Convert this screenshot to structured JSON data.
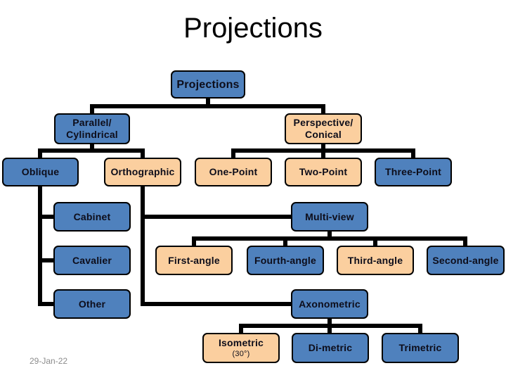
{
  "slide": {
    "title": "Projections",
    "date": "29-Jan-22"
  },
  "colors": {
    "blue_node": "#4f81bd",
    "peach_node": "#fbcf9f",
    "connector": "#000000"
  },
  "nodes": {
    "root": {
      "label": "Projections",
      "color": "blue"
    },
    "parallel": {
      "label": "Parallel/",
      "label2": "Cylindrical",
      "color": "blue"
    },
    "perspective": {
      "label": "Perspective/",
      "label2": "Conical",
      "color": "peach"
    },
    "oblique": {
      "label": "Oblique",
      "color": "blue"
    },
    "orthographic": {
      "label": "Orthographic",
      "color": "peach"
    },
    "one_point": {
      "label": "One-Point",
      "color": "peach"
    },
    "two_point": {
      "label": "Two-Point",
      "color": "peach"
    },
    "three_point": {
      "label": "Three-Point",
      "color": "blue"
    },
    "cabinet": {
      "label": "Cabinet",
      "color": "blue"
    },
    "cavalier": {
      "label": "Cavalier",
      "color": "blue"
    },
    "other": {
      "label": "Other",
      "color": "blue"
    },
    "multiview": {
      "label": "Multi-view",
      "color": "blue"
    },
    "first_angle": {
      "label": "First-angle",
      "color": "peach"
    },
    "fourth_angle": {
      "label": "Fourth-angle",
      "color": "blue"
    },
    "third_angle": {
      "label": "Third-angle",
      "color": "peach"
    },
    "second_angle": {
      "label": "Second-angle",
      "color": "blue"
    },
    "axonometric": {
      "label": "Axonometric",
      "color": "blue"
    },
    "isometric": {
      "label": "Isometric",
      "label2": "(30°)",
      "color": "peach"
    },
    "dimetric": {
      "label": "Di-metric",
      "color": "blue"
    },
    "trimetric": {
      "label": "Trimetric",
      "color": "blue"
    }
  },
  "edges": [
    [
      "root",
      "parallel"
    ],
    [
      "root",
      "perspective"
    ],
    [
      "parallel",
      "oblique"
    ],
    [
      "parallel",
      "orthographic"
    ],
    [
      "perspective",
      "one_point"
    ],
    [
      "perspective",
      "two_point"
    ],
    [
      "perspective",
      "three_point"
    ],
    [
      "oblique",
      "cabinet"
    ],
    [
      "oblique",
      "cavalier"
    ],
    [
      "oblique",
      "other"
    ],
    [
      "orthographic",
      "multiview"
    ],
    [
      "orthographic",
      "axonometric"
    ],
    [
      "multiview",
      "first_angle"
    ],
    [
      "multiview",
      "fourth_angle"
    ],
    [
      "multiview",
      "third_angle"
    ],
    [
      "multiview",
      "second_angle"
    ],
    [
      "axonometric",
      "isometric"
    ],
    [
      "axonometric",
      "dimetric"
    ],
    [
      "axonometric",
      "trimetric"
    ]
  ]
}
